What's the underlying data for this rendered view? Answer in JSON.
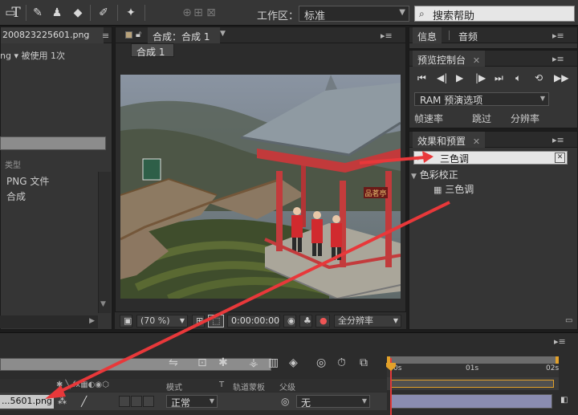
{
  "toolbar": {
    "workspace_label": "工作区：",
    "workspace_value": "标准",
    "help_search_placeholder": "搜索帮助",
    "text_tool": "T"
  },
  "project": {
    "tab_title": "200823225601.png",
    "usage_prefix": "ng ▾",
    "usage_text": "被使用 1次",
    "column_type": "类型",
    "rows": [
      {
        "type": "PNG 文件"
      },
      {
        "type": "合成"
      }
    ]
  },
  "composition": {
    "tab_title": "合成：合成 1",
    "sub_tab": "合成 1",
    "zoom": "(70 %)",
    "timecode": "0:00:00:00",
    "resolution": "全分辨率"
  },
  "info_panel": {
    "tabs": [
      "信息",
      "音频"
    ]
  },
  "preview_panel": {
    "title": "预览控制台",
    "ram_option": "RAM 预演选项",
    "labels": [
      "帧速率",
      "跳过",
      "分辨率"
    ]
  },
  "effects_panel": {
    "title": "效果和预置",
    "search_value": "三色调",
    "category": "色彩校正",
    "item": "三色调"
  },
  "timeline": {
    "layer_name": "...5601.png",
    "col_mode": "模式",
    "col_t": "T",
    "col_trkmat": "轨道蒙板",
    "col_parent": "父级",
    "mode_value": "正常",
    "parent_value": "无",
    "ruler_labels": [
      "0s",
      "01s",
      "02s"
    ]
  },
  "pavilion_sign": "品茗亭",
  "colors": {
    "annotation_arrow": "#e8383a",
    "panel_bg": "#353535",
    "accent_orange": "#e2a12a"
  }
}
